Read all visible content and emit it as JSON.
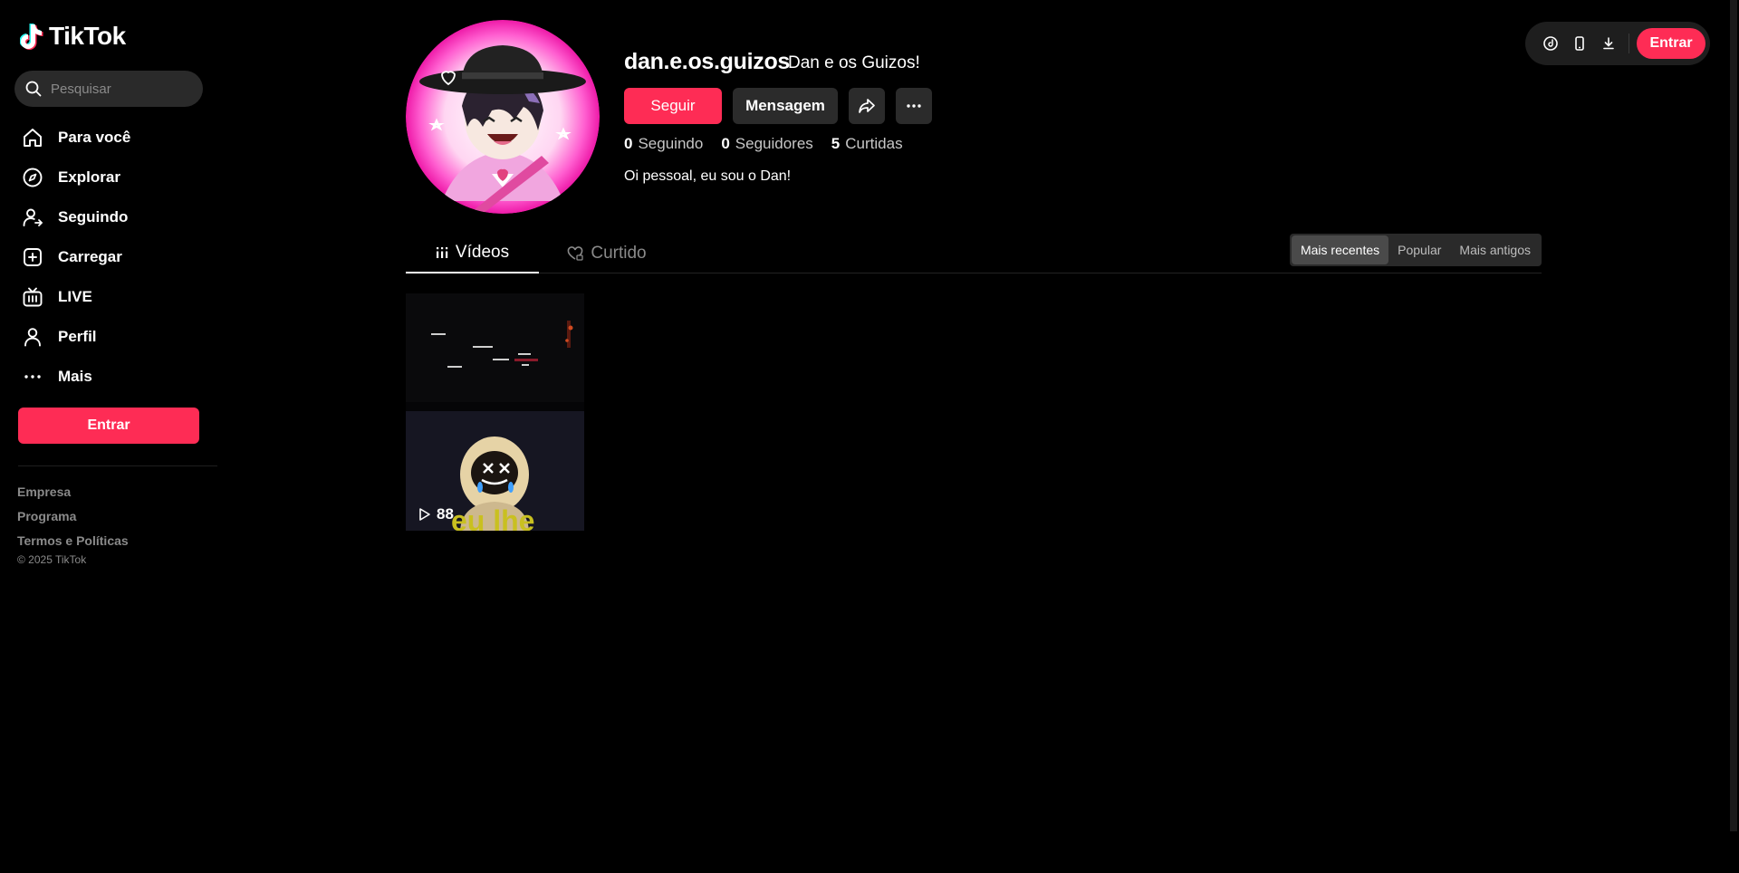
{
  "app": {
    "logo_text": "TikTok"
  },
  "search": {
    "placeholder": "Pesquisar"
  },
  "sidebar": {
    "items": [
      {
        "label": "Para você",
        "icon": "home-icon"
      },
      {
        "label": "Explorar",
        "icon": "compass-icon"
      },
      {
        "label": "Seguindo",
        "icon": "following-icon"
      },
      {
        "label": "Carregar",
        "icon": "upload-icon"
      },
      {
        "label": "LIVE",
        "icon": "live-icon"
      },
      {
        "label": "Perfil",
        "icon": "profile-icon"
      },
      {
        "label": "Mais",
        "icon": "more-icon"
      }
    ],
    "login_label": "Entrar",
    "footer": [
      "Empresa",
      "Programa",
      "Termos e Políticas"
    ],
    "copyright": "© 2025 TikTok"
  },
  "topbar": {
    "icons": [
      "coin-icon",
      "mobile-icon",
      "download-icon"
    ],
    "login_label": "Entrar"
  },
  "profile": {
    "username": "dan.e.os.guizos",
    "nickname": "Dan e os Guizos!",
    "follow_label": "Seguir",
    "message_label": "Mensagem",
    "stats": {
      "following": {
        "value": "0",
        "label": "Seguindo"
      },
      "followers": {
        "value": "0",
        "label": "Seguidores"
      },
      "likes": {
        "value": "5",
        "label": "Curtidas"
      }
    },
    "bio": "Oi pessoal, eu sou o Dan!"
  },
  "tabs": {
    "videos": "Vídeos",
    "liked": "Curtido"
  },
  "sort": {
    "options": [
      "Mais recentes",
      "Popular",
      "Mais antigos"
    ],
    "selected": "Mais recentes"
  },
  "videos": [
    {
      "views": "88",
      "caption_fragment": "eu lhe"
    }
  ],
  "colors": {
    "accent": "#fe2c55",
    "background": "#000000",
    "muted": "#8a8a8a"
  }
}
